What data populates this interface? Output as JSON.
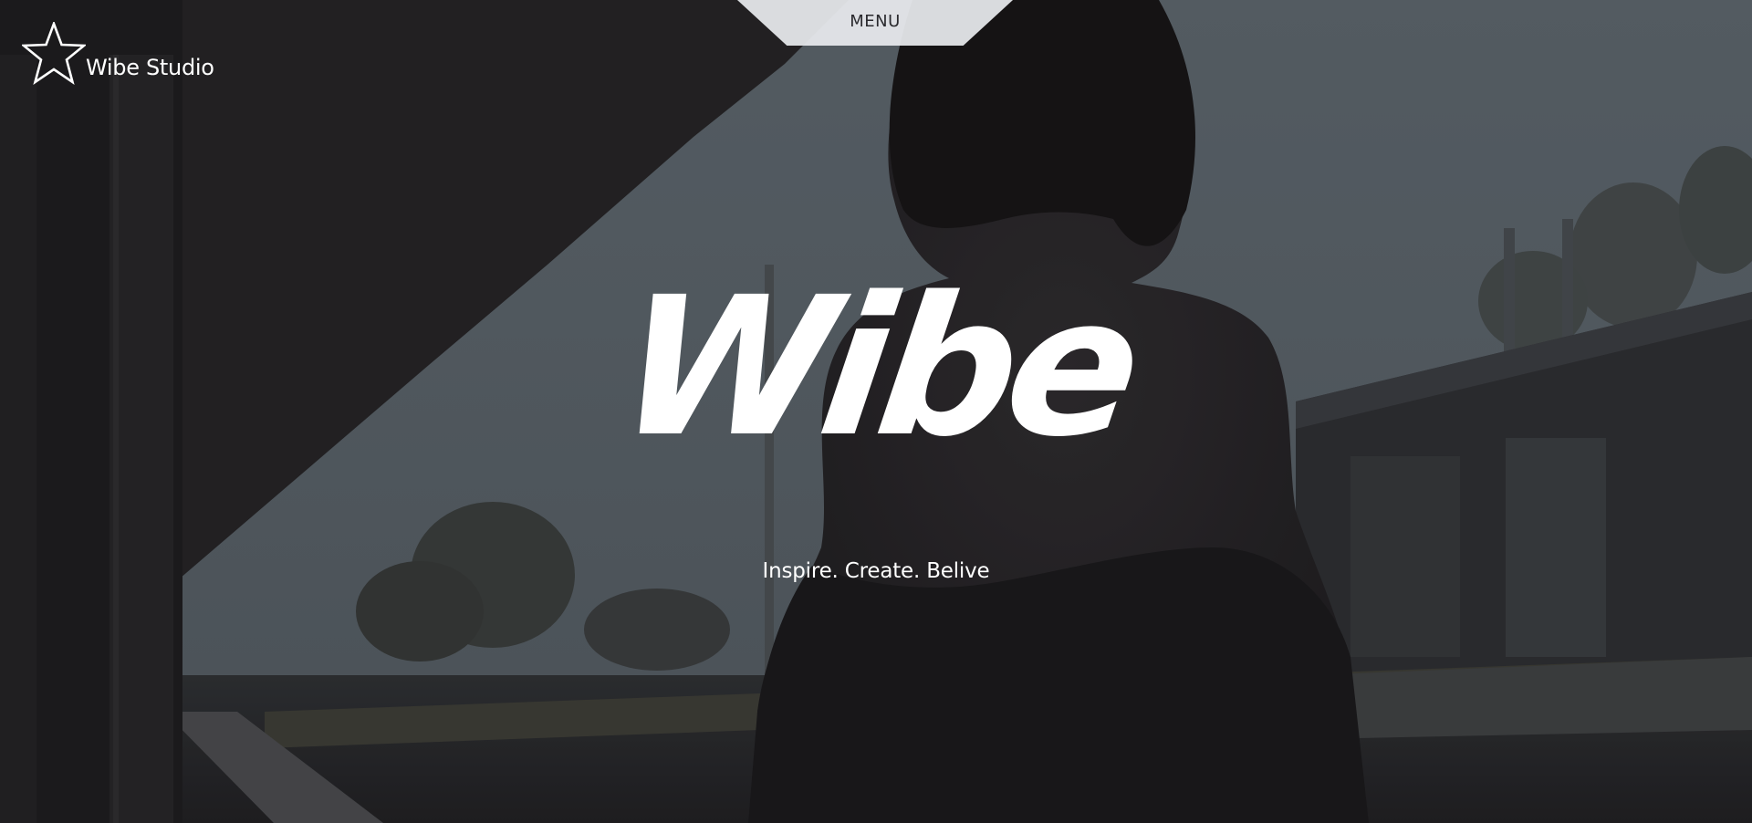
{
  "header": {
    "menu_label": "MENU",
    "logo_icon": "star-outline-icon",
    "logo_text": "Wibe Studio"
  },
  "hero": {
    "title": "Wibe",
    "tagline": "Inspire. Create. Belive"
  },
  "colors": {
    "menu_bg": "#e8ebee",
    "menu_text": "#2a2a2e",
    "text": "#ffffff",
    "sky": "#5d676e",
    "shadow": "#1c1b1d"
  }
}
